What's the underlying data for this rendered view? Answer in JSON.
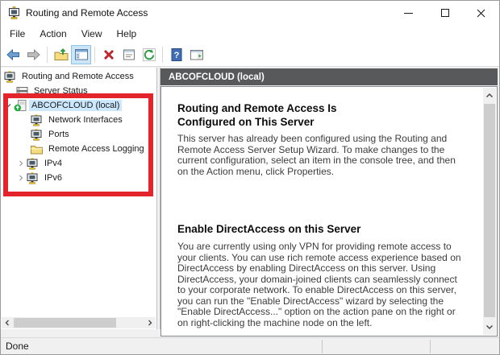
{
  "window": {
    "title": "Routing and Remote Access",
    "control_icons": [
      "minimize-icon",
      "maximize-icon",
      "close-icon"
    ]
  },
  "menu": {
    "items": [
      {
        "label": "File"
      },
      {
        "label": "Action"
      },
      {
        "label": "View"
      },
      {
        "label": "Help"
      }
    ]
  },
  "toolbar": {
    "icons": [
      "back-icon",
      "forward-icon",
      "up-one-level-icon",
      "show-console-tree-icon",
      "delete-icon",
      "properties-icon",
      "refresh-icon",
      "help-icon",
      "action-pane-icon"
    ],
    "active_icon": "show-console-tree-icon"
  },
  "tree": {
    "items": [
      {
        "label": "Routing and Remote Access",
        "level": 0,
        "icon": "rras-monitor-icon",
        "expander": "none",
        "selected": false
      },
      {
        "label": "Server Status",
        "level": 1,
        "icon": "server-status-icon",
        "expander": "none",
        "selected": false
      },
      {
        "label": "ABCOFCLOUD (local)",
        "level": 1,
        "icon": "server-green-arrow-icon",
        "expander": "expanded",
        "selected": true
      },
      {
        "label": "Network Interfaces",
        "level": 2,
        "icon": "rras-monitor-icon",
        "expander": "none",
        "selected": false
      },
      {
        "label": "Ports",
        "level": 2,
        "icon": "rras-monitor-icon",
        "expander": "none",
        "selected": false
      },
      {
        "label": "Remote Access Logging",
        "level": 2,
        "icon": "folder-icon",
        "expander": "none",
        "selected": false
      },
      {
        "label": "IPv4",
        "level": 2,
        "icon": "rras-monitor-icon",
        "expander": "collapsed",
        "selected": false
      },
      {
        "label": "IPv6",
        "level": 2,
        "icon": "rras-monitor-icon",
        "expander": "collapsed",
        "selected": false
      }
    ]
  },
  "detail": {
    "header": "ABCOFCLOUD (local)",
    "sections": [
      {
        "heading": "Routing and Remote Access Is Configured on This Server",
        "body": "This server has already been configured using the Routing and Remote Access Server Setup Wizard. To make changes to the current configuration, select an item in the console tree, and then on the Action menu, click Properties."
      },
      {
        "heading": "Enable DirectAccess on this Server",
        "body": "You are currently using only VPN for providing remote access to your clients. You can use rich remote access experience based on DirectAccess by enabling DirectAccess on this server. Using DirectAccess, your domain-joined clients can seamlessly connect to your corporate network. To enable DirectAccess on this server, you can run the \"Enable DirectAccess\" wizard by selecting the \"Enable DirectAccess...\" option on the action pane on the right or on right-clicking the machine node on the left."
      }
    ]
  },
  "statusbar": {
    "text": "Done"
  },
  "annotation": {
    "shape": "rectangle",
    "color": "#e3242b",
    "purpose": "highlights ABCOFCLOUD (local) node and its children"
  },
  "colors": {
    "pane_header_bg": "#58595b",
    "selection_bg": "#cce8ff",
    "annotation_red": "#e3242b",
    "scrollbar_thumb": "#cdcdcd",
    "statusbar_bg": "#f0f0f0"
  }
}
